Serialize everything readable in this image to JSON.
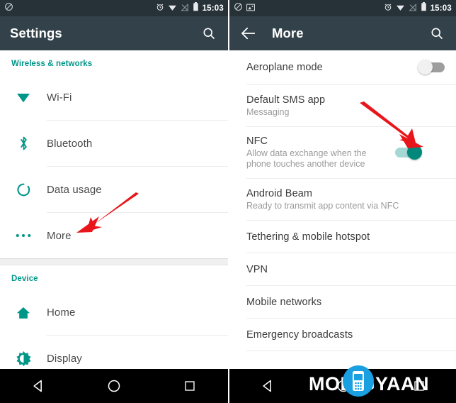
{
  "left_phone": {
    "status_bar": {
      "icons": [
        "rotation-lock-icon",
        "alarm-icon",
        "wifi-icon",
        "signal-off-icon",
        "battery-icon"
      ],
      "time": "15:03"
    },
    "app_bar": {
      "title": "Settings",
      "search_icon": "search-icon"
    },
    "sections": [
      {
        "header": "Wireless & networks",
        "items": [
          {
            "icon": "wifi-icon",
            "label": "Wi-Fi"
          },
          {
            "icon": "bluetooth-icon",
            "label": "Bluetooth"
          },
          {
            "icon": "data-usage-icon",
            "label": "Data usage"
          },
          {
            "icon": "more-dots-icon",
            "label": "More"
          }
        ]
      },
      {
        "header": "Device",
        "items": [
          {
            "icon": "home-icon",
            "label": "Home"
          },
          {
            "icon": "display-brightness-icon",
            "label": "Display"
          }
        ]
      }
    ],
    "nav_bar": {
      "back": "back-triangle-icon",
      "home": "home-circle-icon",
      "recents": "recents-square-icon"
    },
    "annotation_arrow": {
      "name": "red-arrow-pointing-to-more",
      "color": "#e8161a",
      "points_to": "More"
    }
  },
  "right_phone": {
    "status_bar": {
      "icons": [
        "rotation-lock-icon",
        "screenshot-icon",
        "alarm-icon",
        "wifi-icon",
        "signal-off-icon",
        "battery-icon"
      ],
      "time": "15:03"
    },
    "app_bar": {
      "back_icon": "back-arrow-icon",
      "title": "More",
      "search_icon": "search-icon"
    },
    "items": [
      {
        "label": "Aeroplane mode",
        "sub": "",
        "toggle": "off"
      },
      {
        "label": "Default SMS app",
        "sub": "Messaging",
        "toggle": null
      },
      {
        "label": "NFC",
        "sub": "Allow data exchange when the phone touches another device",
        "toggle": "on"
      },
      {
        "label": "Android Beam",
        "sub": "Ready to transmit app content via NFC",
        "toggle": null
      },
      {
        "label": "Tethering & mobile hotspot",
        "sub": "",
        "toggle": null
      },
      {
        "label": "VPN",
        "sub": "",
        "toggle": null
      },
      {
        "label": "Mobile networks",
        "sub": "",
        "toggle": null
      },
      {
        "label": "Emergency broadcasts",
        "sub": "",
        "toggle": null
      }
    ],
    "nav_bar": {
      "back": "back-triangle-icon",
      "home": "home-circle-icon",
      "recents": "recents-square-icon"
    },
    "annotation_arrow": {
      "name": "red-arrow-pointing-to-nfc-toggle",
      "color": "#e8161a",
      "points_to": "NFC toggle"
    },
    "watermark": {
      "text": "MOBIGYAAN",
      "logo": "mobile-phone-logo",
      "logo_color": "#1a9fe0"
    }
  },
  "colors": {
    "accent_teal": "#009688",
    "app_bar": "#33424a",
    "status_bar": "#263238",
    "arrow_red": "#e8161a",
    "toggle_on": "#00897b"
  }
}
